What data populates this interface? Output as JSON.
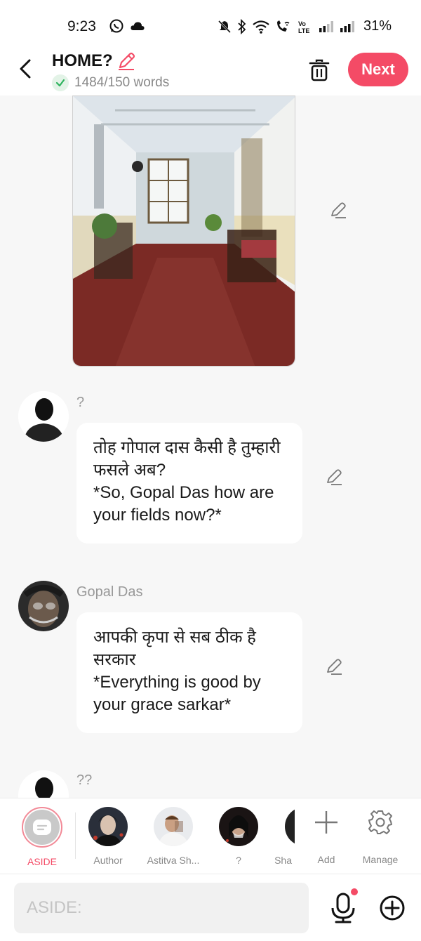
{
  "status_bar": {
    "time": "9:23",
    "battery": "31%",
    "icons": [
      "whatsapp-icon",
      "cloud-icon",
      "mute-icon",
      "bluetooth-icon",
      "wifi-icon",
      "wifi-calling-icon",
      "volte-icon",
      "signal-icon",
      "signal-icon"
    ]
  },
  "header": {
    "title": "HOME?",
    "word_count": "1484/150 words",
    "next_label": "Next"
  },
  "messages": [
    {
      "speaker": "?",
      "lines": [
        "तोह गोपाल दास कैसी है तुम्हारी फसले अब?",
        "*So, Gopal Das how are your fields now?*"
      ]
    },
    {
      "speaker": "Gopal Das",
      "lines": [
        "आपकी कृपा से सब ठीक है सरकार",
        "*Everything is good by your grace sarkar*"
      ]
    },
    {
      "speaker": "??",
      "lines": []
    }
  ],
  "characters": [
    {
      "label": "ASIDE",
      "selected": true
    },
    {
      "label": "Author"
    },
    {
      "label": "Astitva Sh..."
    },
    {
      "label": "?"
    },
    {
      "label": "Sha"
    }
  ],
  "actions": {
    "add_label": "Add",
    "manage_label": "Manage"
  },
  "composer": {
    "placeholder": "ASIDE:"
  },
  "colors": {
    "accent": "#f44b66",
    "success": "#2db35d",
    "bubble": "#ffffff",
    "background": "#f7f7f7"
  }
}
